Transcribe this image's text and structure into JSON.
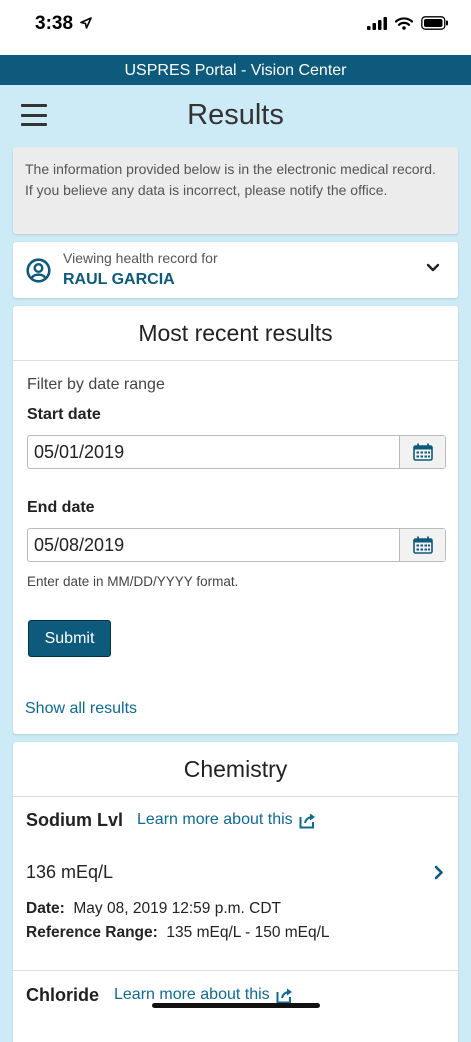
{
  "status_bar": {
    "time": "3:38"
  },
  "app": {
    "title": "USPRES Portal - Vision Center"
  },
  "header": {
    "page_title": "Results"
  },
  "notice": {
    "text": "The information provided below is in the electronic medical record. If you believe any data is incorrect, please notify the office."
  },
  "record": {
    "label": "Viewing health record for",
    "patient_name": "RAUL GARCIA"
  },
  "results_card": {
    "heading": "Most recent results",
    "filter_label": "Filter by date range",
    "start_label": "Start date",
    "start_value": "05/01/2019",
    "end_label": "End date",
    "end_value": "05/08/2019",
    "hint": "Enter date in MM/DD/YYYY format.",
    "submit_label": "Submit",
    "show_all_label": "Show all results"
  },
  "chemistry": {
    "heading": "Chemistry",
    "tests": [
      {
        "name": "Sodium Lvl",
        "learn_more": "Learn more about this",
        "value": "136 mEq/L",
        "date_label": "Date:",
        "date_value": "May 08, 2019 12:59 p.m. CDT",
        "range_label": "Reference Range:",
        "range_value": "135 mEq/L - 150 mEq/L"
      },
      {
        "name": "Chloride",
        "learn_more": "Learn more about this"
      }
    ]
  },
  "colors": {
    "brand": "#0d5a7c",
    "link": "#0d6a93",
    "page_bg": "#cdeaf7"
  }
}
